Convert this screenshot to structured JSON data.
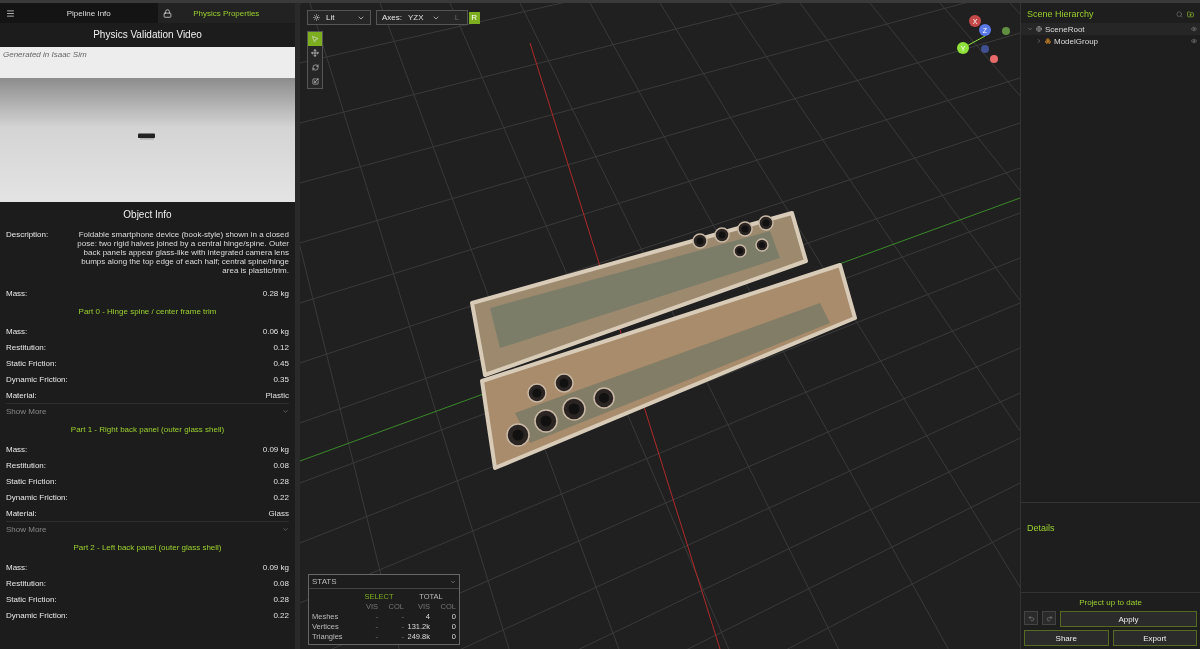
{
  "left_panel": {
    "tabs": [
      {
        "label": "Pipeline Info",
        "kind": "pipeline",
        "selected": false
      },
      {
        "label": "Physics Properties",
        "kind": "physics",
        "selected": true
      }
    ],
    "video": {
      "title": "Physics Validation Video",
      "caption": "Generated in Isaac Sim"
    },
    "object_info": {
      "title": "Object Info",
      "description_label": "Description:",
      "description": "Foldable smartphone device (book-style) shown in a closed pose: two rigid halves joined by a central hinge/spine. Outer back panels appear glass-like with integrated camera lens bumps along the top edge of each half; central spine/hinge area is plastic/trim.",
      "mass_label": "Mass:",
      "mass": "0.28 kg"
    },
    "parts": [
      {
        "title": "Part 0 - Hinge spine / center frame trim",
        "properties": [
          {
            "label": "Mass:",
            "value": "0.06 kg"
          },
          {
            "label": "Restitution:",
            "value": "0.12"
          },
          {
            "label": "Static Friction:",
            "value": "0.45"
          },
          {
            "label": "Dynamic Friction:",
            "value": "0.35"
          },
          {
            "label": "Material:",
            "value": "Plastic"
          }
        ],
        "show_more": "Show More"
      },
      {
        "title": "Part 1 - Right back panel (outer glass shell)",
        "properties": [
          {
            "label": "Mass:",
            "value": "0.09 kg"
          },
          {
            "label": "Restitution:",
            "value": "0.08"
          },
          {
            "label": "Static Friction:",
            "value": "0.28"
          },
          {
            "label": "Dynamic Friction:",
            "value": "0.22"
          },
          {
            "label": "Material:",
            "value": "Glass"
          }
        ],
        "show_more": "Show More"
      },
      {
        "title": "Part 2 - Left back panel (outer glass shell)",
        "properties": [
          {
            "label": "Mass:",
            "value": "0.09 kg"
          },
          {
            "label": "Restitution:",
            "value": "0.08"
          },
          {
            "label": "Static Friction:",
            "value": "0.28"
          },
          {
            "label": "Dynamic Friction:",
            "value": "0.22"
          }
        ]
      }
    ]
  },
  "viewport": {
    "shading": "Lit",
    "axes_label": "Axes:",
    "axes": "YZX",
    "handedness": [
      {
        "label": "L",
        "selected": false
      },
      {
        "label": "R",
        "selected": true
      }
    ],
    "tools": [
      {
        "kind": "select",
        "selected": true
      },
      {
        "kind": "move",
        "selected": false
      },
      {
        "kind": "rotate",
        "selected": false
      },
      {
        "kind": "scale",
        "selected": false
      }
    ],
    "gizmo": [
      {
        "label": "X",
        "kind": "x"
      },
      {
        "label": "Z",
        "kind": "z"
      },
      {
        "label": "Y",
        "kind": "y"
      }
    ],
    "stats": {
      "title": "STATS",
      "groups": [
        "SELECT",
        "TOTAL"
      ],
      "columns": [
        "VIS",
        "COL",
        "VIS",
        "COL"
      ],
      "rows": [
        {
          "label": "Meshes",
          "values": [
            "-",
            "-",
            "4",
            "0"
          ]
        },
        {
          "label": "Vertices",
          "values": [
            "-",
            "-",
            "131.2k",
            "0"
          ]
        },
        {
          "label": "Triangles",
          "values": [
            "-",
            "-",
            "249.8k",
            "0"
          ]
        }
      ]
    }
  },
  "right_panel": {
    "title": "Scene Hierarchy",
    "tree": [
      {
        "label": "SceneRoot",
        "kind": "root",
        "expanded": true,
        "children": [
          {
            "label": "ModelGroup",
            "kind": "group",
            "expanded": false
          }
        ]
      }
    ],
    "details": {
      "title": "Details"
    },
    "status": "Project up to date",
    "apply": "Apply",
    "share": "Share",
    "export": "Export"
  }
}
